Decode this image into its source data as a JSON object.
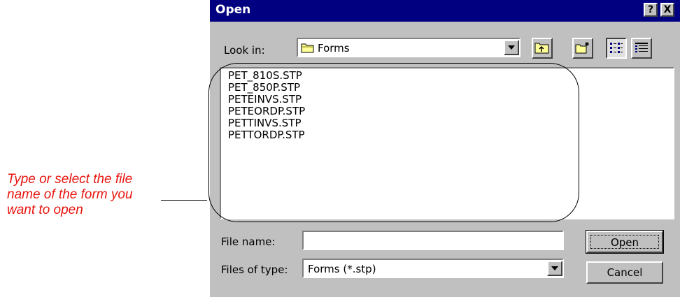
{
  "annotation": {
    "text_line1": "Type or select the file",
    "text_line2": "name of the form you",
    "text_line3": "want to open"
  },
  "dialog": {
    "title": "Open",
    "help_button": "?",
    "close_button": "X",
    "look_in_label": "Look in:",
    "look_in_value": "Forms",
    "files": [
      "PET_810S.STP",
      "PET_850P.STP",
      "PETEINVS.STP",
      "PETEORDP.STP",
      "PETTINVS.STP",
      "PETTORDP.STP"
    ],
    "file_name_label": "File name:",
    "file_name_value": "",
    "files_of_type_label": "Files of type:",
    "files_of_type_value": "Forms (*.stp)",
    "open_button": "Open",
    "cancel_button": "Cancel"
  }
}
